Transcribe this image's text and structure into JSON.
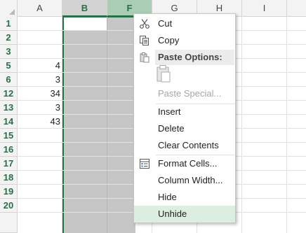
{
  "columns": [
    {
      "label": "A",
      "state": "normal"
    },
    {
      "label": "B",
      "state": "selected"
    },
    {
      "label": "F",
      "state": "selected-active"
    },
    {
      "label": "G",
      "state": "normal"
    },
    {
      "label": "H",
      "state": "normal"
    },
    {
      "label": "I",
      "state": "normal"
    }
  ],
  "rows": [
    {
      "num": "1",
      "a": ""
    },
    {
      "num": "2",
      "a": ""
    },
    {
      "num": "3",
      "a": ""
    },
    {
      "num": "5",
      "a": "4"
    },
    {
      "num": "6",
      "a": "3"
    },
    {
      "num": "12",
      "a": "34"
    },
    {
      "num": "13",
      "a": "3"
    },
    {
      "num": "14",
      "a": "43"
    },
    {
      "num": "15",
      "a": ""
    },
    {
      "num": "16",
      "a": ""
    },
    {
      "num": "17",
      "a": ""
    },
    {
      "num": "18",
      "a": ""
    },
    {
      "num": "19",
      "a": ""
    },
    {
      "num": "20",
      "a": ""
    }
  ],
  "context_menu": {
    "cut": "Cut",
    "copy": "Copy",
    "paste_options": "Paste Options:",
    "paste_special": "Paste Special...",
    "insert": "Insert",
    "delete": "Delete",
    "clear_contents": "Clear Contents",
    "format_cells": "Format Cells...",
    "column_width": "Column Width...",
    "hide": "Hide",
    "unhide": "Unhide",
    "hovered_item": "Unhide"
  },
  "colors": {
    "accent": "#217346",
    "selection_fill": "#c6c6c6",
    "menu_hover": "#dbeedf"
  }
}
